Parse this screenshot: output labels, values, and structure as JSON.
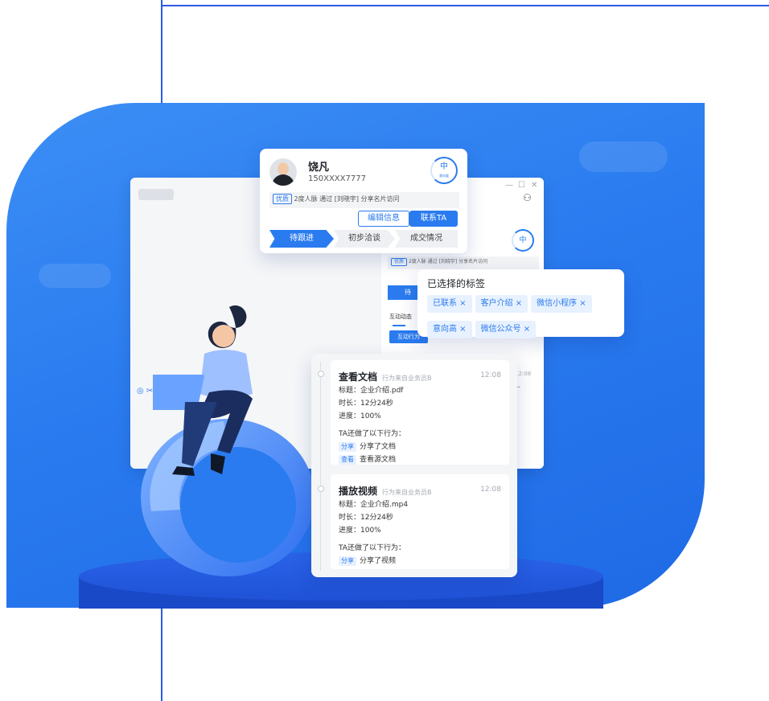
{
  "profile": {
    "name": "饶凡",
    "phone": "150XXXX7777",
    "level": "中",
    "level_sub": "意向度",
    "tag_badge": "优质",
    "info_text": "2度人脉 通过 [刘晓宇] 分享名片访问",
    "edit_label": "编辑信息",
    "contact_label": "联系TA",
    "stages": [
      "待跟进",
      "初步洽谈",
      "成交情况"
    ]
  },
  "back_window": {
    "side_level": "中",
    "side_tag": "优质",
    "side_info": "2度人脉 通过 [刘晓宇] 分享名片访问",
    "side_stage": "待",
    "tab_label": "互动动态",
    "filter_label": "互动行为",
    "side_snippet": "—",
    "left_icons": "◎ ✂",
    "time_snippet": "12:08"
  },
  "tags_panel": {
    "title": "已选择的标签",
    "tags": [
      "已联系 ×",
      "客户介绍 ×",
      "微信小程序 ×",
      "意向高 ×",
      "微信公众号 ×"
    ]
  },
  "timeline": [
    {
      "title": "查看文档",
      "source": "行为来自业务员B",
      "time": "12:08",
      "lines": [
        "标题：企业介绍.pdf",
        "时长：12分24秒",
        "进度：100%"
      ],
      "also": "TA还做了以下行为：",
      "actions": [
        {
          "tag": "分享",
          "text": "分享了文档"
        },
        {
          "tag": "查看",
          "text": "查看源文档"
        }
      ]
    },
    {
      "title": "播放视频",
      "source": "行为来自业务员B",
      "time": "12:08",
      "lines": [
        "标题：企业介绍.mp4",
        "时长：12分24秒",
        "进度：100%"
      ],
      "also": "TA还做了以下行为：",
      "actions": [
        {
          "tag": "分享",
          "text": "分享了视频"
        }
      ]
    }
  ],
  "colors": {
    "accent": "#2a7bef",
    "frame_line": "#2f5be0",
    "backdrop": "#2a7bef"
  }
}
